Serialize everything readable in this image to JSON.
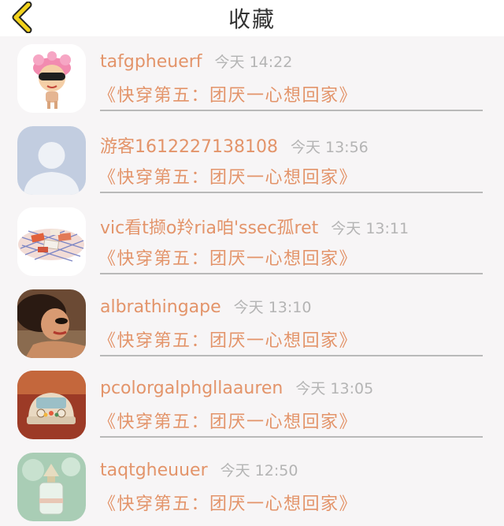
{
  "header": {
    "title": "收藏",
    "back_icon": "chevron-left-icon",
    "accent_color": "#f2d21c"
  },
  "colors": {
    "name": "#e3946a",
    "time": "#b4b4b4",
    "divider": "#b9b9b9"
  },
  "items": [
    {
      "username": "tafgpheuerf",
      "time": "今天 14:22",
      "book": "《快穿第五：团厌一心想回家》",
      "avatar": "cartoon-girl-avatar"
    },
    {
      "username": "游客1612227138108",
      "time": "今天 13:56",
      "book": "《快穿第五：团厌一心想回家》",
      "avatar": "default-user-avatar"
    },
    {
      "username": "vic看t撷o羚ria咱'ssec孤ret",
      "time": "今天 13:11",
      "book": "《快穿第五：团厌一心想回家》",
      "avatar": "food-grill-avatar"
    },
    {
      "username": "albrathingape",
      "time": "今天 13:10",
      "book": "《快穿第五：团厌一心想回家》",
      "avatar": "portrait-avatar"
    },
    {
      "username": "pcolorgalphgllaauren",
      "time": "今天 13:05",
      "book": "《快穿第五：团厌一心想回家》",
      "avatar": "vintage-car-avatar"
    },
    {
      "username": "taqtgheuuer",
      "time": "今天 12:50",
      "book": "《快穿第五：团厌一心想回家》",
      "avatar": "perfume-bottle-avatar"
    }
  ]
}
